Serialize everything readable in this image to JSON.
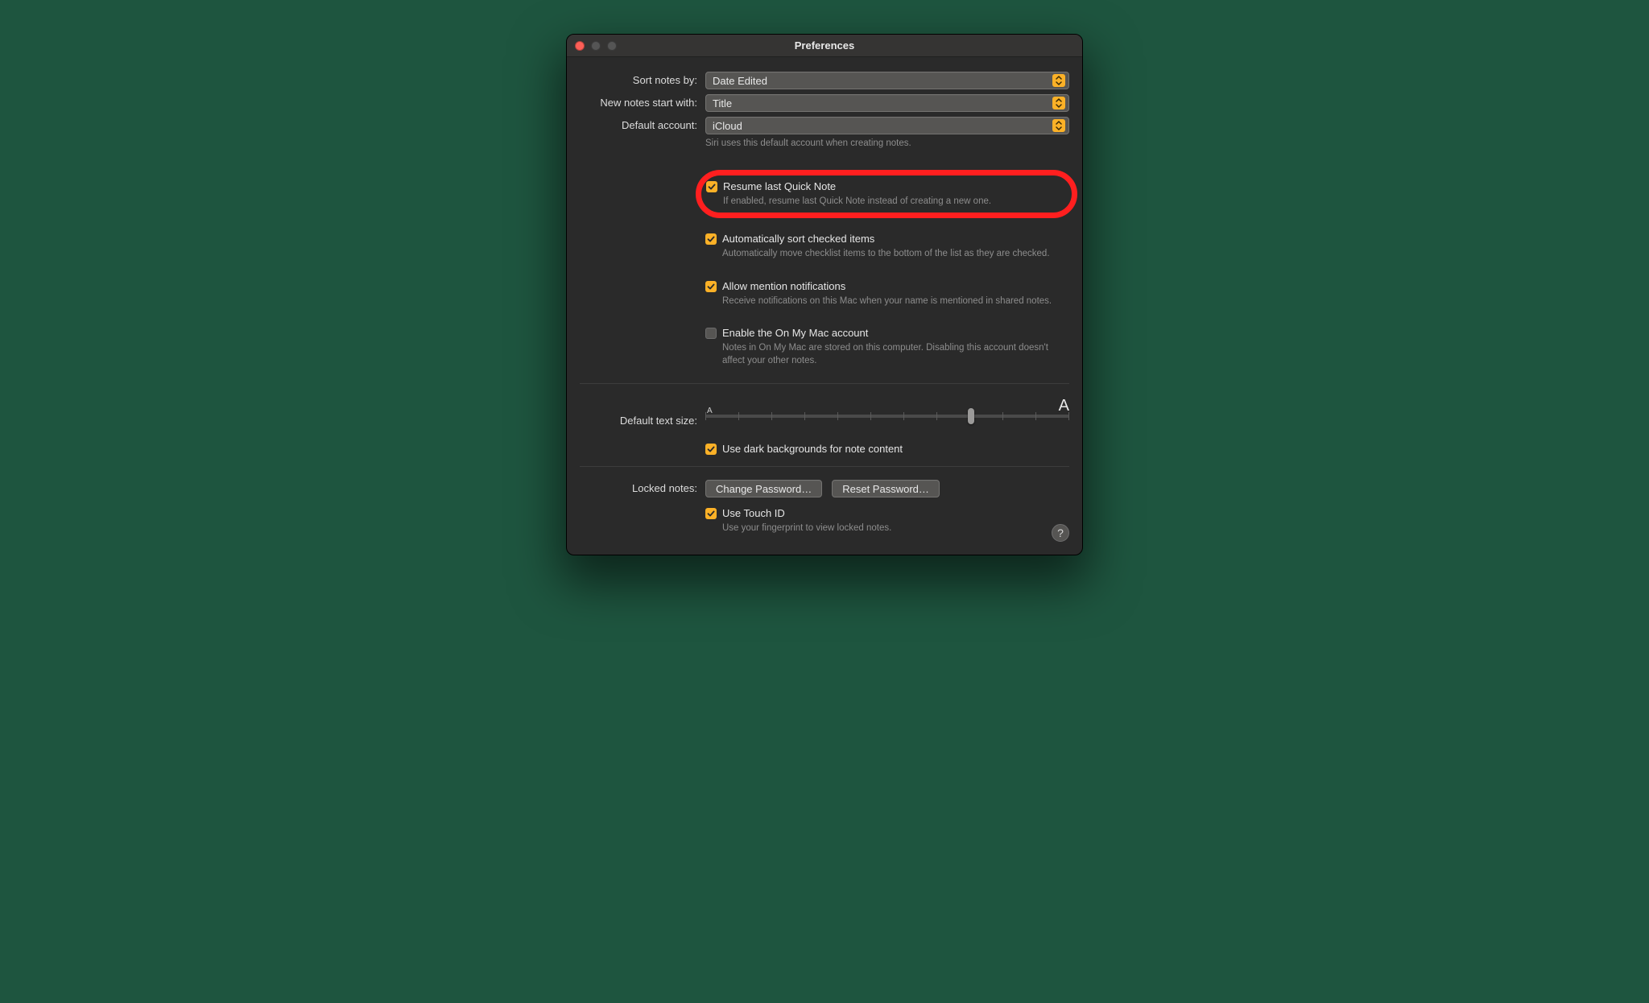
{
  "window": {
    "title": "Preferences"
  },
  "labels": {
    "sort_by": "Sort notes by:",
    "start_with": "New notes start with:",
    "default_account": "Default account:",
    "default_text_size": "Default text size:",
    "locked_notes": "Locked notes:"
  },
  "selects": {
    "sort_by": "Date Edited",
    "start_with": "Title",
    "default_account": "iCloud"
  },
  "hints": {
    "siri": "Siri uses this default account when creating notes.",
    "resume": "If enabled, resume last Quick Note instead of creating a new one.",
    "auto_sort": "Automatically move checklist items to the bottom of the list as they are checked.",
    "mentions": "Receive notifications on this Mac when your name is mentioned in shared notes.",
    "on_my_mac": "Notes in On My Mac are stored on this computer. Disabling this account doesn't affect your other notes.",
    "touch_id": "Use your fingerprint to view locked notes."
  },
  "checks": {
    "resume": {
      "label": "Resume last Quick Note",
      "checked": true
    },
    "auto_sort": {
      "label": "Automatically sort checked items",
      "checked": true
    },
    "mentions": {
      "label": "Allow mention notifications",
      "checked": true
    },
    "on_my_mac": {
      "label": "Enable the On My Mac account",
      "checked": false
    },
    "dark_bg": {
      "label": "Use dark backgrounds for note content",
      "checked": true
    },
    "touch_id": {
      "label": "Use Touch ID",
      "checked": true
    }
  },
  "text_size": {
    "slider_value_pct": 73,
    "label_small": "A",
    "label_big": "A"
  },
  "buttons": {
    "change_password": "Change Password…",
    "reset_password": "Reset Password…"
  },
  "help_glyph": "?"
}
